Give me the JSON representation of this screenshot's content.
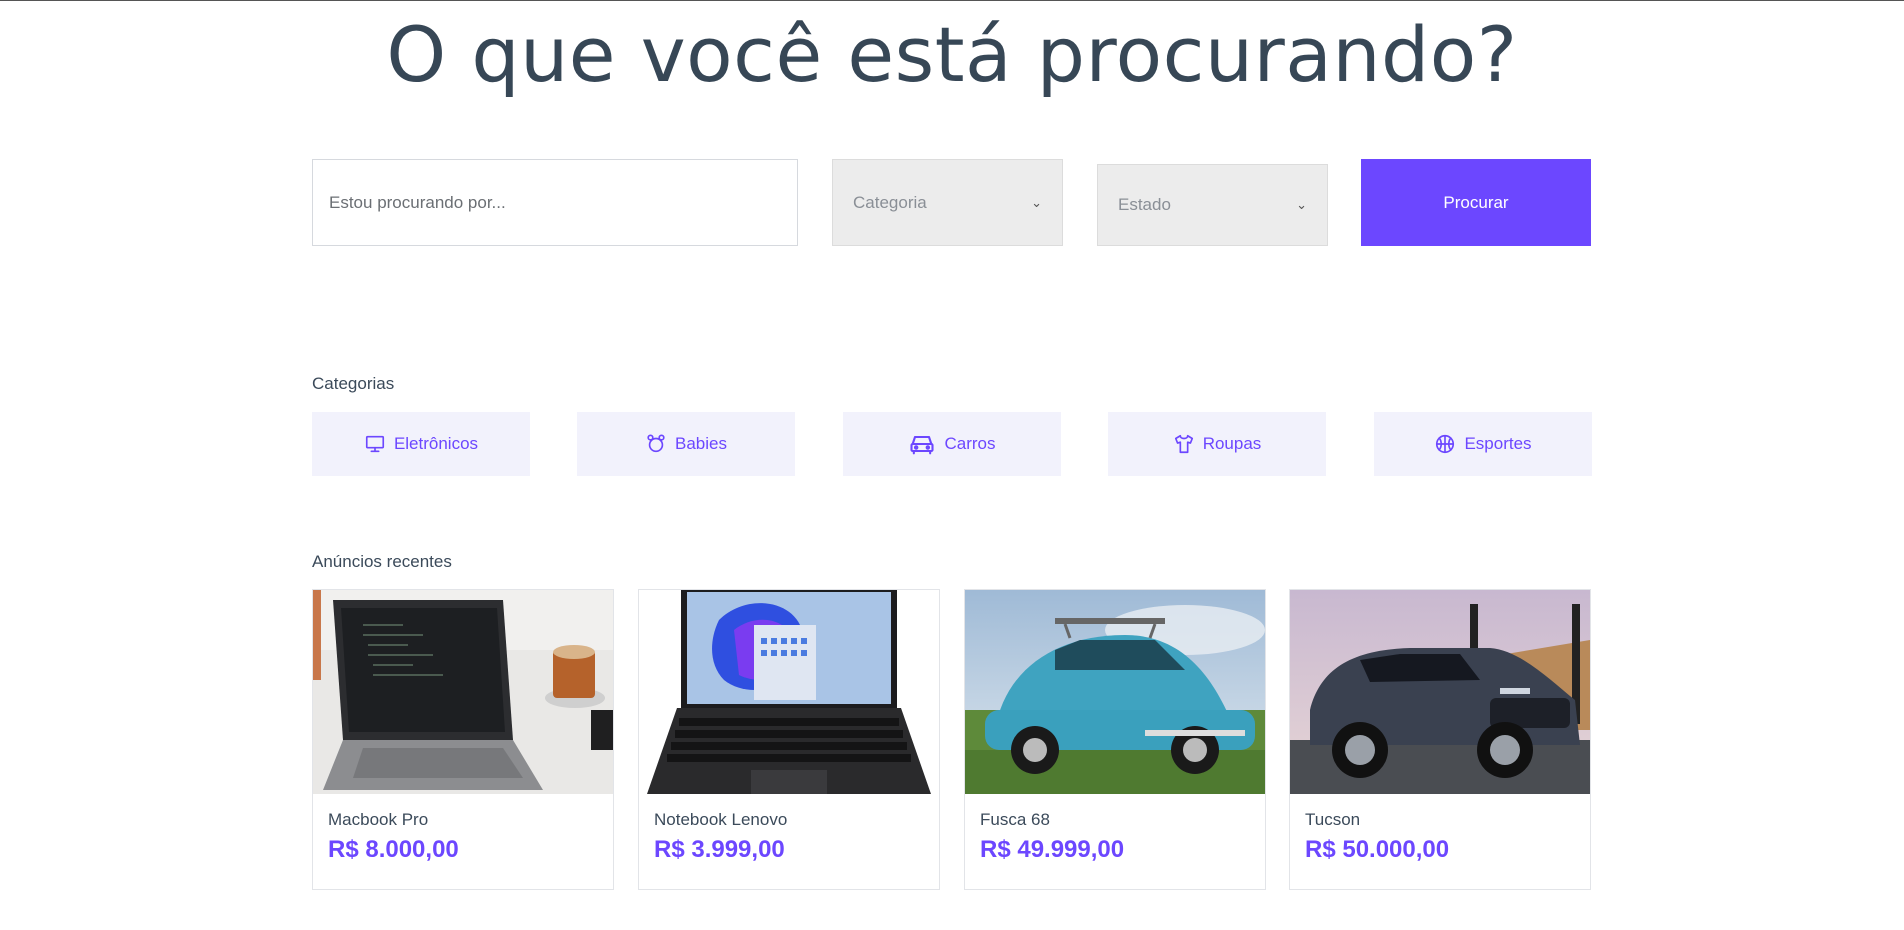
{
  "hero": {
    "title": "O que você está procurando?"
  },
  "search": {
    "placeholder": "Estou procurando por...",
    "category_select": "Categoria",
    "state_select": "Estado",
    "button_label": "Procurar"
  },
  "categories": {
    "heading": "Categorias",
    "items": [
      {
        "label": "Eletrônicos",
        "icon": "monitor-icon"
      },
      {
        "label": "Babies",
        "icon": "baby-icon"
      },
      {
        "label": "Carros",
        "icon": "car-icon"
      },
      {
        "label": "Roupas",
        "icon": "shirt-icon"
      },
      {
        "label": "Esportes",
        "icon": "basketball-icon"
      }
    ]
  },
  "ads": {
    "heading": "Anúncios recentes",
    "items": [
      {
        "title": "Macbook Pro",
        "price": "R$ 8.000,00"
      },
      {
        "title": "Notebook Lenovo",
        "price": "R$ 3.999,00"
      },
      {
        "title": "Fusca 68",
        "price": "R$ 49.999,00"
      },
      {
        "title": "Tucson",
        "price": "R$ 50.000,00"
      }
    ]
  },
  "colors": {
    "accent": "#6c47ff",
    "text": "#374756",
    "category_bg": "#f2f2fc",
    "select_bg": "#ececec"
  }
}
